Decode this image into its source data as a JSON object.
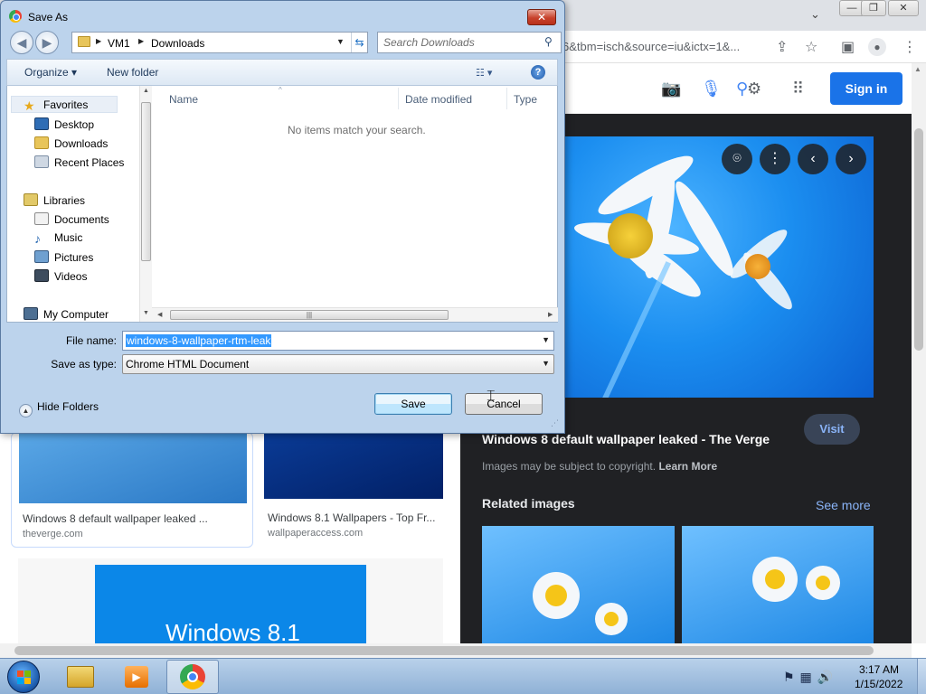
{
  "chrome": {
    "url_fragment": "6&tbm=isch&source=iu&ictx=1&...",
    "signin_label": "Sign in",
    "results": [
      {
        "title": "Windows 8 default wallpaper leaked ...",
        "source": "theverge.com"
      },
      {
        "title": "Windows 8.1 Wallpapers - Top Fr...",
        "source": "wallpaperaccess.com"
      },
      {
        "overlay_text": "Windows 8.1"
      }
    ],
    "panel": {
      "visit_label": "Visit",
      "title": "Windows 8 default wallpaper leaked - The Verge",
      "copyright_text": "Images may be subject to copyright.",
      "learn_more": "Learn More",
      "related_title": "Related images",
      "see_more": "See more"
    }
  },
  "dialog": {
    "title": "Save As",
    "close_glyph": "✕",
    "breadcrumb": [
      "VM1",
      "Downloads"
    ],
    "search_placeholder": "Search Downloads",
    "toolbar": {
      "organize": "Organize ▾",
      "new_folder": "New folder"
    },
    "nav": {
      "favorites": "Favorites",
      "desktop": "Desktop",
      "downloads": "Downloads",
      "recent": "Recent Places",
      "libraries": "Libraries",
      "documents": "Documents",
      "music": "Music",
      "pictures": "Pictures",
      "videos": "Videos",
      "computer": "My Computer"
    },
    "columns": [
      "Name",
      "Date modified",
      "Type"
    ],
    "empty_message": "No items match your search.",
    "file_name_label": "File name:",
    "file_name_value": "windows-8-wallpaper-rtm-leak",
    "save_type_label": "Save as type:",
    "save_type_value": "Chrome HTML Document",
    "hide_folders": "Hide Folders",
    "save_label": "Save",
    "cancel_label": "Cancel"
  },
  "taskbar": {
    "time": "3:17 AM",
    "date": "1/15/2022"
  },
  "colors": {
    "google_blue": "#1a73e8",
    "panel_bg": "#202124",
    "link_blue": "#8ab4f8"
  }
}
